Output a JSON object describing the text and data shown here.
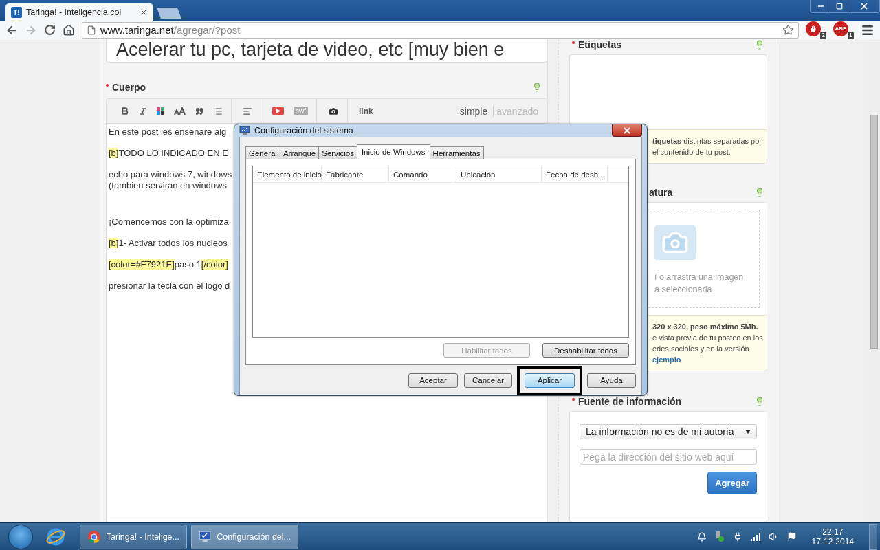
{
  "browser": {
    "tab": {
      "favicon": "T!",
      "title": "Taringa! - Inteligencia col"
    },
    "url": {
      "host": "www.taringa.net",
      "path": "/agregar/?post"
    },
    "extensions": [
      {
        "kind": "stop",
        "badge": "2"
      },
      {
        "kind": "abp",
        "label": "ABP",
        "badge": "1"
      }
    ]
  },
  "post": {
    "title": "Acelerar tu pc, tarjeta de video, etc [muy bien e",
    "body_label": "Cuerpo",
    "toolbar_texts": {
      "swf": "swf",
      "link": "link"
    },
    "modes": [
      {
        "label": "simple",
        "selected": true
      },
      {
        "label": "avanzado",
        "selected": false
      }
    ],
    "paragraphs": [
      [
        [
          {
            "text": "En este post les enseñare alg",
            "tag": false
          }
        ]
      ],
      [
        [
          {
            "text": "[b]",
            "tag": true
          },
          {
            "text": "TODO LO INDICADO EN E",
            "tag": false
          }
        ]
      ],
      [
        [
          {
            "text": "echo para windows 7, windows",
            "tag": false
          }
        ],
        [
          {
            "text": "(tambien serviran en windows",
            "tag": false
          }
        ]
      ],
      [
        [
          {
            "text": "¡Comencemos con la optimiza",
            "tag": false
          }
        ]
      ],
      [
        [
          {
            "text": "[b]",
            "tag": true
          },
          {
            "text": "1- Activar todos los nucleos",
            "tag": false
          }
        ]
      ],
      [
        [
          {
            "text": "[color=#F7921E]",
            "tag": true
          },
          {
            "text": "paso 1",
            "tag": false
          },
          {
            "text": "[/color]",
            "tag": true
          }
        ]
      ],
      [
        [
          {
            "text": "presionar la tecla con el logo d",
            "tag": false
          }
        ]
      ]
    ]
  },
  "sidebar": {
    "tags": {
      "label": "Etiquetas",
      "hint": [
        "**tiquetas** distintas separadas por",
        "el contenido de tu post."
      ]
    },
    "cover": {
      "label": "atura",
      "upload": [
        "í o arrastra una imagen",
        "a seleccionarla"
      ],
      "note": [
        "**320 x 320, peso máximo 5Mb.**",
        "e vista previa de tu posteo en los",
        "edes sociales y en la versión"
      ],
      "link": "ejemplo"
    },
    "source": {
      "label": "Fuente de información",
      "select": "La información no es de mi autoría",
      "placeholder": "Pega la dirección del sitio web aquí",
      "button": "Agregar"
    }
  },
  "dialog": {
    "title": "Configuración del sistema",
    "tabs": [
      {
        "label": "General",
        "selected": false
      },
      {
        "label": "Arranque",
        "selected": false
      },
      {
        "label": "Servicios",
        "selected": false
      },
      {
        "label": "Inicio de Windows",
        "selected": true
      },
      {
        "label": "Herramientas",
        "selected": false
      }
    ],
    "columns": [
      "Elemento de inicio",
      "Fabricante",
      "Comando",
      "Ubicación",
      "Fecha de desh..."
    ],
    "list_buttons": [
      {
        "label": "Habilitar todos",
        "disabled": true
      },
      {
        "label": "Deshabilitar todos",
        "disabled": false
      }
    ],
    "buttons": [
      {
        "label": "Aceptar",
        "focused": false,
        "highlighted": false
      },
      {
        "label": "Cancelar",
        "focused": false,
        "highlighted": false
      },
      {
        "label": "Aplicar",
        "focused": true,
        "highlighted": true
      },
      {
        "label": "Ayuda",
        "focused": false,
        "highlighted": false
      }
    ]
  },
  "taskbar": {
    "tasks": [
      {
        "kind": "browser",
        "label": "Taringa! - Intelige...",
        "active": false
      },
      {
        "kind": "config",
        "label": "Configuración del...",
        "active": true
      }
    ],
    "time": "22:17",
    "date": "17-12-2014"
  }
}
